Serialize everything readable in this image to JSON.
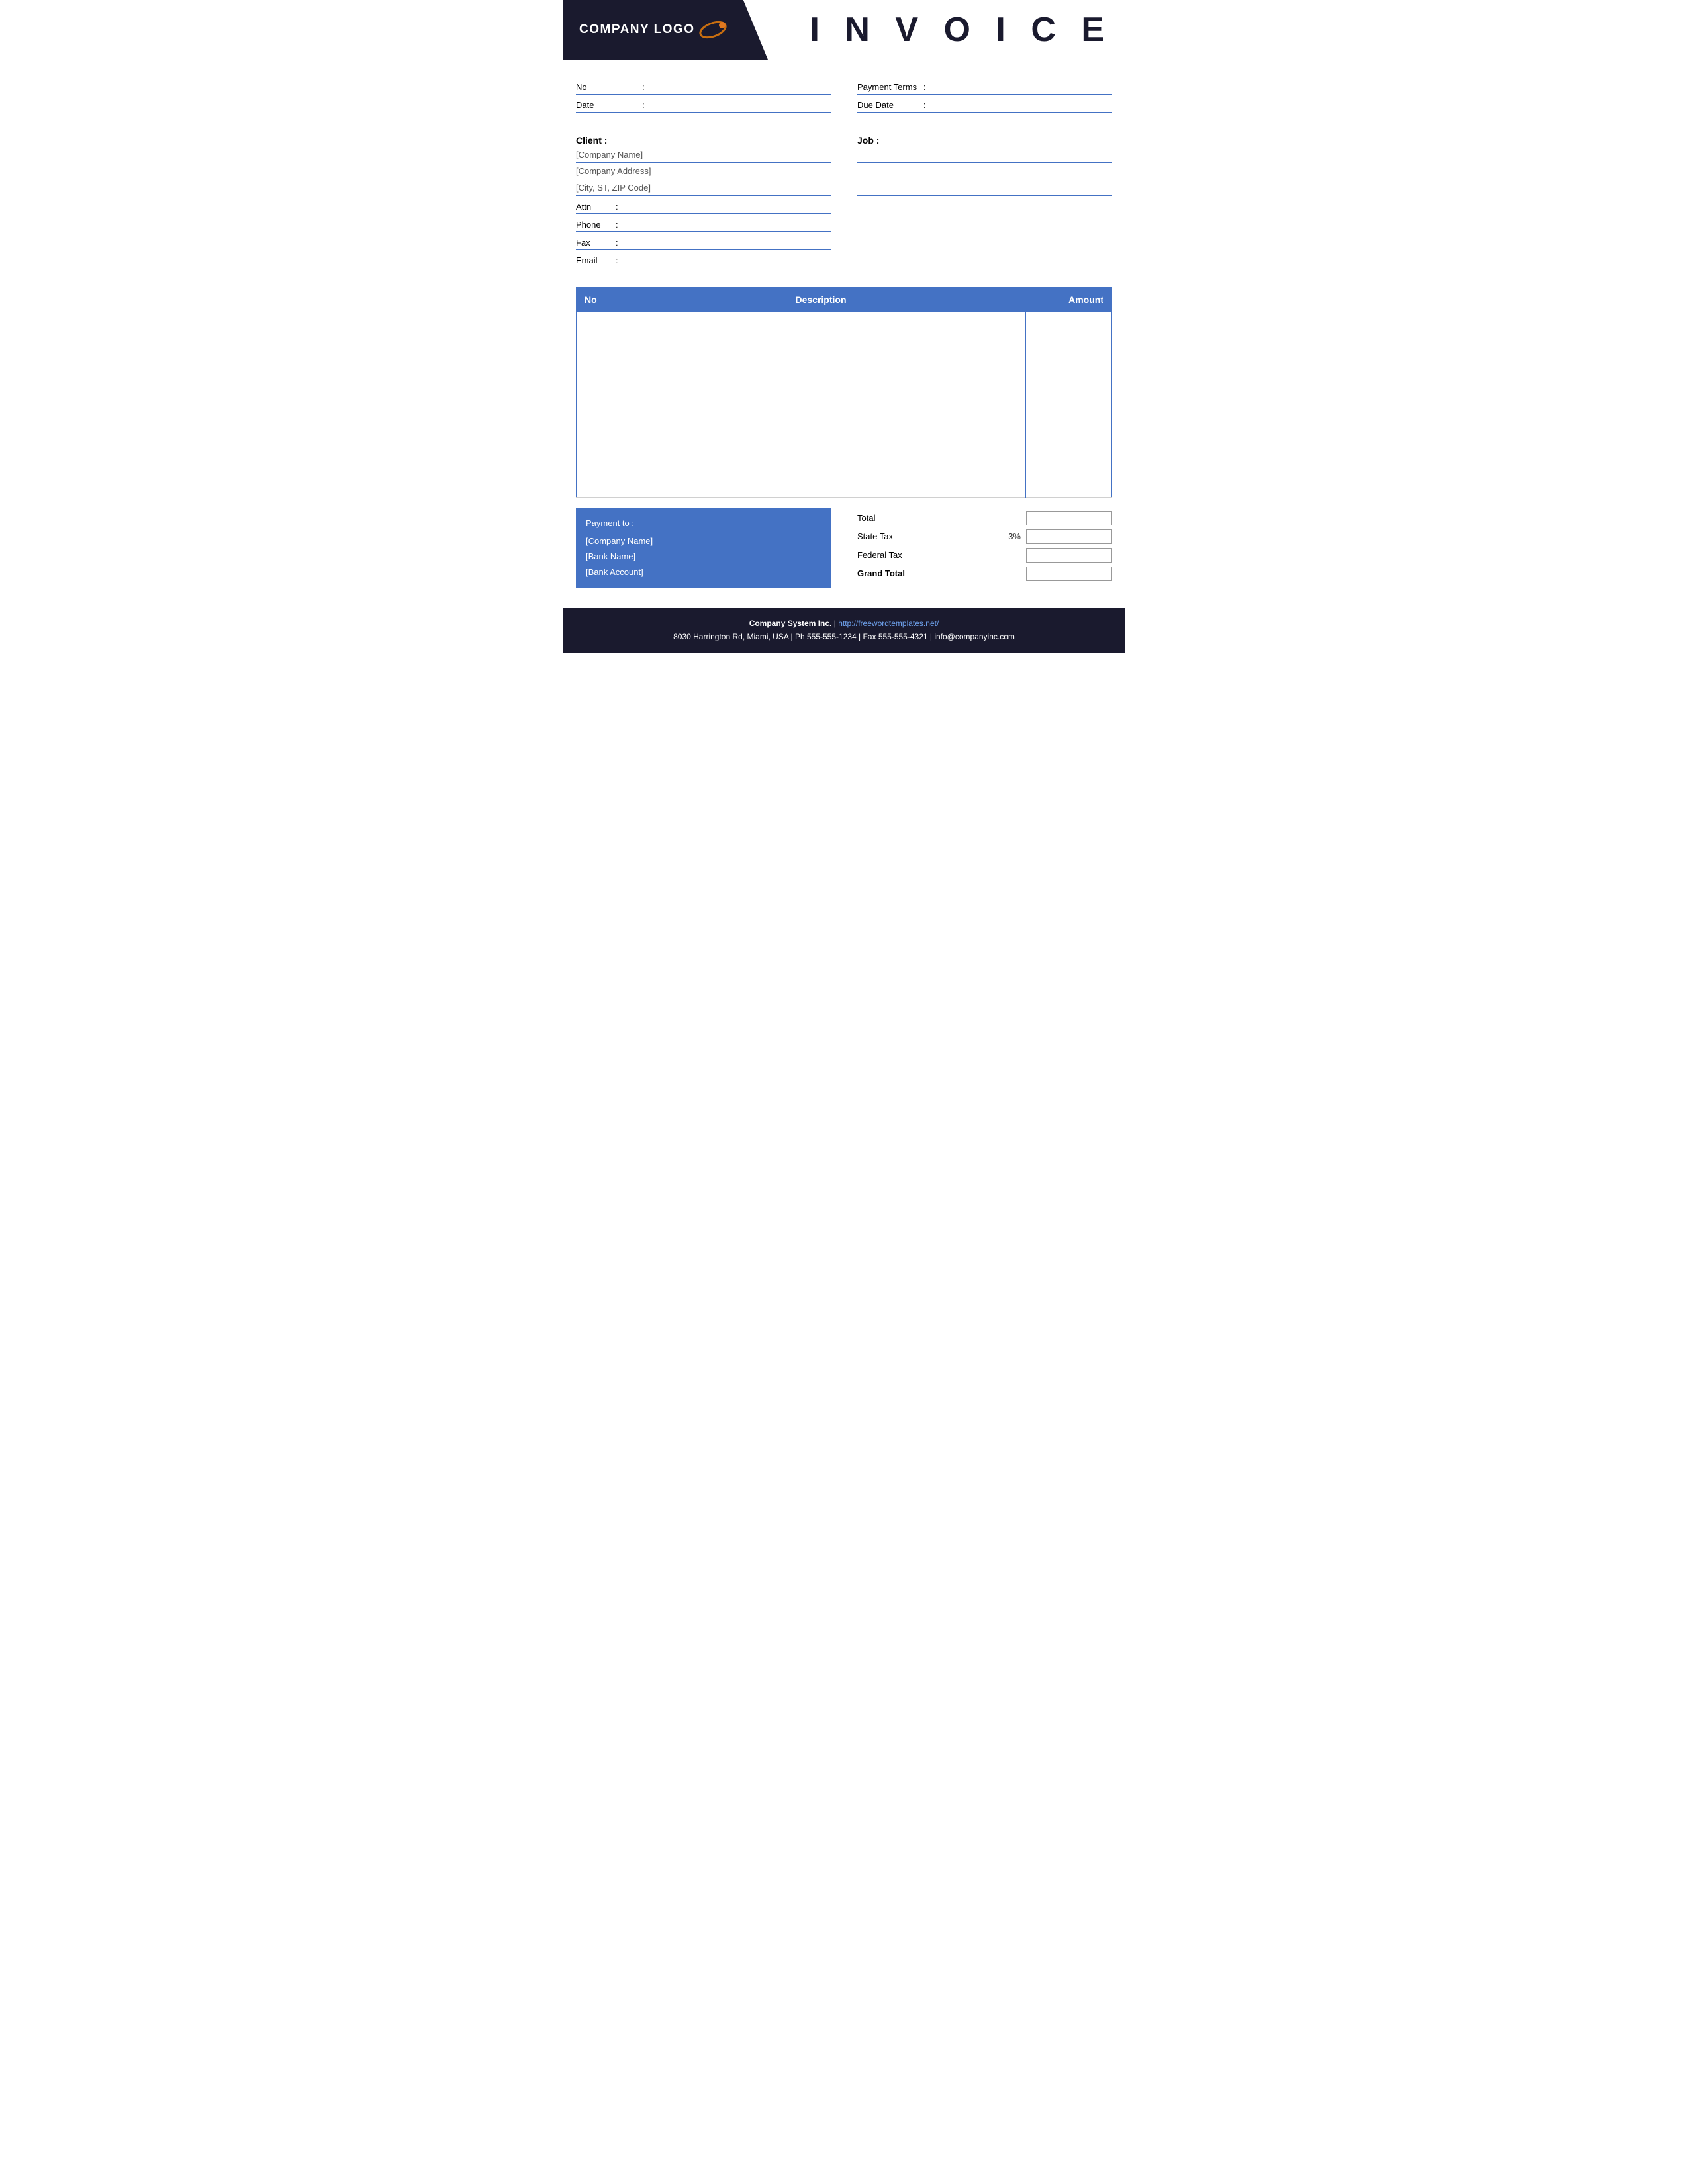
{
  "header": {
    "logo_text": "COMPANY LOGO",
    "invoice_title": "I N V O I C E"
  },
  "info": {
    "no_label": "No",
    "no_colon": ":",
    "no_value": "",
    "date_label": "Date",
    "date_colon": ":",
    "date_value": "",
    "payment_terms_label": "Payment  Terms",
    "payment_terms_colon": ":",
    "payment_terms_value": "",
    "due_date_label": "Due Date",
    "due_date_colon": ":",
    "due_date_value": ""
  },
  "client": {
    "label": "Client  :",
    "company_name": "[Company Name]",
    "company_address": "[Company Address]",
    "city": "[City, ST, ZIP Code]",
    "attn_label": "Attn",
    "attn_colon": ":",
    "attn_value": "",
    "phone_label": "Phone",
    "phone_colon": ":",
    "phone_value": "",
    "fax_label": "Fax",
    "fax_colon": ":",
    "fax_value": "",
    "email_label": "Email",
    "email_colon": ":",
    "email_value": ""
  },
  "job": {
    "label": "Job  :",
    "line1": "",
    "line2": "",
    "line3": "",
    "line4": ""
  },
  "table": {
    "col_no": "No",
    "col_description": "Description",
    "col_amount": "Amount",
    "rows": [
      {
        "no": "",
        "description": "",
        "amount": ""
      }
    ]
  },
  "payment": {
    "label": "Payment to :",
    "company_name": "[Company Name]",
    "bank_name": "[Bank Name]",
    "bank_account": "[Bank Account]"
  },
  "totals": {
    "total_label": "Total",
    "total_value": "",
    "state_tax_label": "State Tax",
    "state_tax_percent": "3%",
    "state_tax_value": "",
    "federal_tax_label": "Federal Tax",
    "federal_tax_value": "",
    "grand_total_label": "Grand Total",
    "grand_total_value": ""
  },
  "footer": {
    "company": "Company System Inc.",
    "pipe1": " | ",
    "website": "http://freewordtemplates.net/",
    "pipe2": "",
    "address_line": "8030 Harrington Rd, Miami, USA | Ph 555-555-1234 | Fax 555-555-4321 | info@companyinc.com"
  }
}
